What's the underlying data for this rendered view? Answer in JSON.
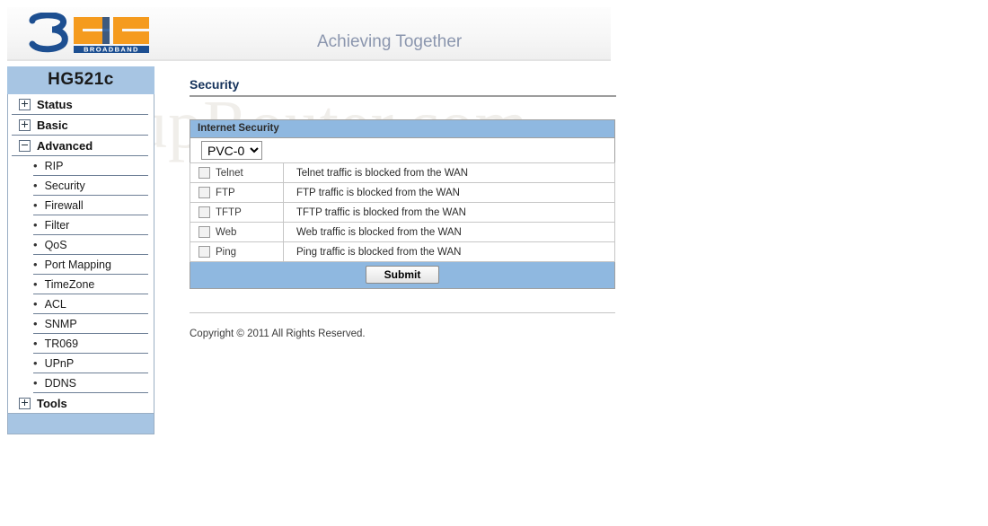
{
  "header": {
    "logo_text_3": "3",
    "logo_text_bb": "BB",
    "logo_subtext": "BROADBAND",
    "tagline": "Achieving Together"
  },
  "watermark": {
    "text": "SetupRouter.com"
  },
  "sidebar": {
    "title": "HG521c",
    "top_items": [
      {
        "label": "Status",
        "state": "collapsed"
      },
      {
        "label": "Basic",
        "state": "collapsed"
      },
      {
        "label": "Advanced",
        "state": "expanded"
      }
    ],
    "advanced_items": [
      {
        "label": "RIP"
      },
      {
        "label": "Security"
      },
      {
        "label": "Firewall"
      },
      {
        "label": "Filter"
      },
      {
        "label": "QoS"
      },
      {
        "label": "Port Mapping"
      },
      {
        "label": "TimeZone"
      },
      {
        "label": "ACL"
      },
      {
        "label": "SNMP"
      },
      {
        "label": "TR069"
      },
      {
        "label": "UPnP"
      },
      {
        "label": "DDNS"
      }
    ],
    "tools_item": {
      "label": "Tools",
      "state": "collapsed"
    }
  },
  "main": {
    "page_title": "Security",
    "panel_title": "Internet Security",
    "pvc": {
      "selected": "PVC-0",
      "options": [
        "PVC-0"
      ]
    },
    "rows": [
      {
        "label": "Telnet",
        "checked": false,
        "description": "Telnet traffic is blocked from the WAN"
      },
      {
        "label": "FTP",
        "checked": false,
        "description": "FTP traffic is blocked from the WAN"
      },
      {
        "label": "TFTP",
        "checked": false,
        "description": "TFTP traffic is blocked from the WAN"
      },
      {
        "label": "Web",
        "checked": false,
        "description": "Web traffic is blocked from the WAN"
      },
      {
        "label": "Ping",
        "checked": false,
        "description": "Ping traffic is blocked from the WAN"
      }
    ],
    "submit_label": "Submit"
  },
  "footer": {
    "copyright": "Copyright © 2011 All Rights Reserved."
  },
  "colors": {
    "band_blue": "#8fb8e0",
    "sidebar_blue": "#a7c5e3",
    "title_navy": "#15325b",
    "logo_blue": "#1d4f91",
    "logo_orange": "#f59b1e",
    "tagline_gray": "#8b96ae"
  }
}
